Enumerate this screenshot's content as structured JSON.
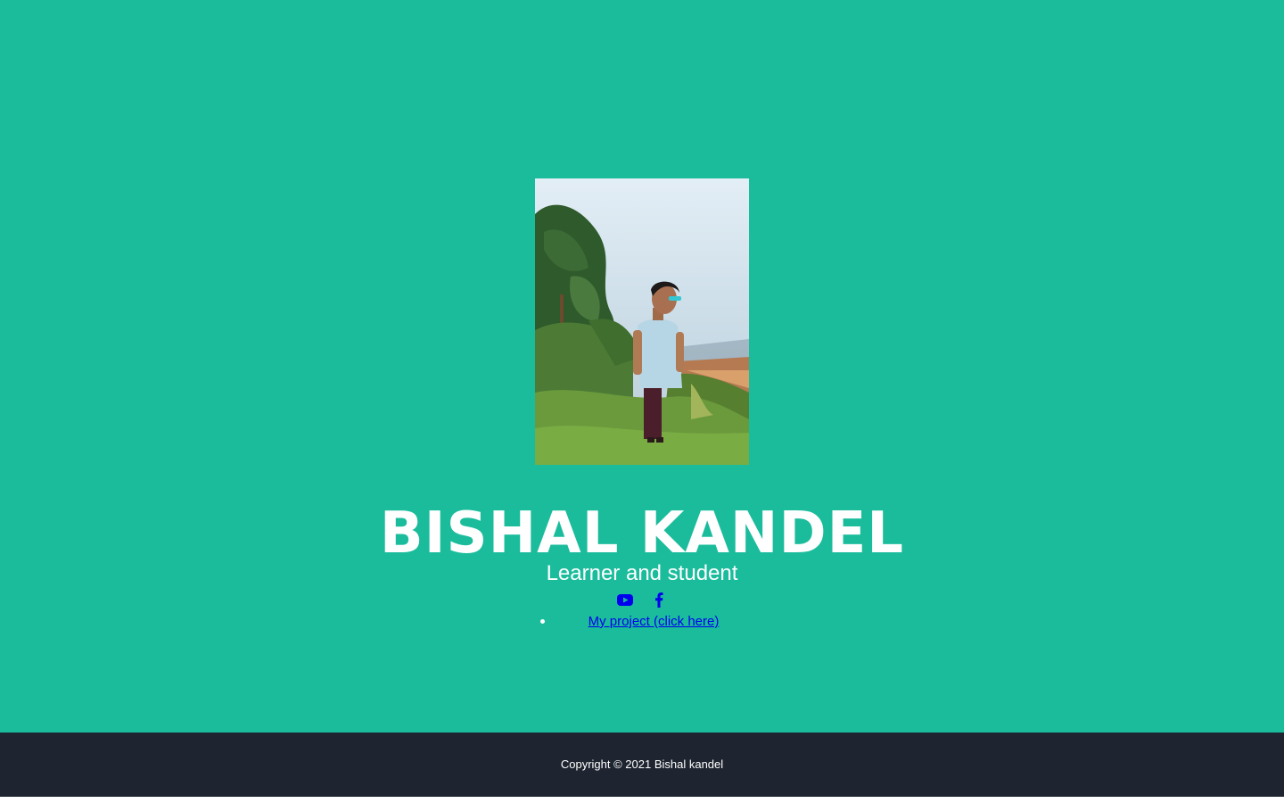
{
  "header": {
    "name": "BISHAL KANDEL",
    "tagline": "Learner and student",
    "photo_alt": "Profile photo"
  },
  "social": [
    {
      "icon": "youtube-icon",
      "color": "#0000ee"
    },
    {
      "icon": "facebook-icon",
      "color": "#0000ee"
    }
  ],
  "projects": {
    "link_text": "My project (click here)"
  },
  "footer": {
    "copyright": "Copyright © 2021 Bishal kandel"
  },
  "colors": {
    "masthead": "#1abc9c",
    "footer": "#1e2530",
    "link": "#0000ee"
  }
}
